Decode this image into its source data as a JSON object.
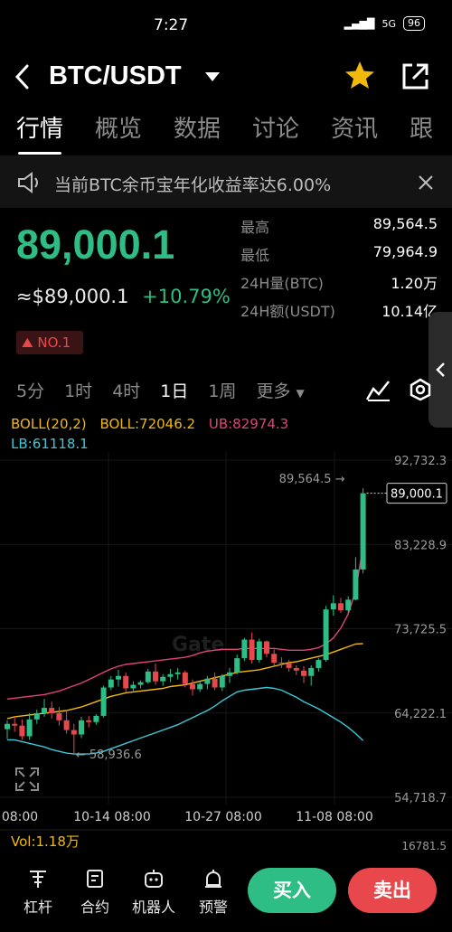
{
  "status_bar": {
    "time": "7:27",
    "battery": "96",
    "network": "5G"
  },
  "header": {
    "pair": "BTC/USDT",
    "favorite": true
  },
  "tabs": [
    "行情",
    "概览",
    "数据",
    "讨论",
    "资讯",
    "跟"
  ],
  "notice": {
    "text": "当前BTC余币宝年化收益率达6.00%"
  },
  "ticker": {
    "last_price": "89,000.1",
    "fiat_price": "≈$89,000.1",
    "change": "+10.79%",
    "rank": "NO.1",
    "stats": [
      {
        "label": "最高",
        "value": "89,564.5"
      },
      {
        "label": "最低",
        "value": "79,964.9"
      },
      {
        "label": "24H量(BTC)",
        "value": "1.20万"
      },
      {
        "label": "24H额(USDT)",
        "value": "10.14亿"
      }
    ]
  },
  "periods": {
    "items": [
      "5分",
      "1时",
      "4时",
      "1日",
      "1周",
      "更多"
    ],
    "selected": "1日"
  },
  "indicator": {
    "boll_params": "BOLL(20,2)",
    "boll": "BOLL:72046.2",
    "ub": "UB:82974.3",
    "lb": "LB:61118.1"
  },
  "chart_data": {
    "type": "candlestick",
    "y_ticks": [
      "92,732.3",
      "83,228.9",
      "73,725.5",
      "64,222.1",
      "54,718.7"
    ],
    "x_ticks": [
      "08:00",
      "10-14 08:00",
      "10-27 08:00",
      "11-08 08:00"
    ],
    "high_label": "89,564.5",
    "low_label": "58,936.6",
    "last_label": "89,000.1",
    "ylim": [
      54718.7,
      92732.3
    ],
    "candles": [
      [
        62400,
        63400,
        61300,
        63000
      ],
      [
        63000,
        63800,
        62100,
        62800
      ],
      [
        62800,
        63500,
        61200,
        61600
      ],
      [
        61600,
        64200,
        61200,
        63500
      ],
      [
        63500,
        64600,
        63000,
        64200
      ],
      [
        64200,
        65800,
        63800,
        64800
      ],
      [
        64800,
        65500,
        63600,
        64200
      ],
      [
        64200,
        64900,
        62800,
        63400
      ],
      [
        63400,
        64600,
        61900,
        62300
      ],
      [
        62300,
        63000,
        59600,
        61800
      ],
      [
        61800,
        63800,
        61400,
        63400
      ],
      [
        63400,
        63900,
        62600,
        63200
      ],
      [
        63200,
        64100,
        62900,
        63900
      ],
      [
        63900,
        67300,
        63700,
        67100
      ],
      [
        67100,
        68400,
        66800,
        68000
      ],
      [
        68000,
        69100,
        67200,
        68400
      ],
      [
        68400,
        68800,
        66600,
        67000
      ],
      [
        67000,
        67800,
        66700,
        67400
      ],
      [
        67400,
        67900,
        67000,
        67700
      ],
      [
        67700,
        69200,
        67500,
        68900
      ],
      [
        68900,
        69800,
        67400,
        67800
      ],
      [
        67800,
        68600,
        67300,
        68300
      ],
      [
        68300,
        69200,
        67700,
        68600
      ],
      [
        68600,
        69300,
        68000,
        68800
      ],
      [
        68800,
        69000,
        67100,
        67500
      ],
      [
        67500,
        68000,
        66200,
        66900
      ],
      [
        66900,
        67800,
        66600,
        67500
      ],
      [
        67500,
        68400,
        66900,
        68100
      ],
      [
        68100,
        68800,
        66800,
        67100
      ],
      [
        67100,
        68600,
        66700,
        68400
      ],
      [
        68400,
        69300,
        67600,
        68800
      ],
      [
        68800,
        70800,
        68600,
        70400
      ],
      [
        70400,
        72700,
        70100,
        72500
      ],
      [
        72500,
        73300,
        69800,
        70200
      ],
      [
        70200,
        72600,
        69900,
        72300
      ],
      [
        72300,
        72400,
        70500,
        70900
      ],
      [
        70900,
        71400,
        69600,
        69900
      ],
      [
        69900,
        70500,
        69300,
        69800
      ],
      [
        69800,
        70200,
        68900,
        69300
      ],
      [
        69300,
        69600,
        68500,
        69000
      ],
      [
        69000,
        69500,
        67600,
        68400
      ],
      [
        68400,
        69600,
        67300,
        69300
      ],
      [
        69300,
        70400,
        68900,
        70200
      ],
      [
        70200,
        76300,
        70000,
        75900
      ],
      [
        75900,
        77500,
        75200,
        76600
      ],
      [
        76600,
        77200,
        75500,
        75800
      ],
      [
        75800,
        77400,
        75500,
        77000
      ],
      [
        77000,
        81800,
        76900,
        80400
      ],
      [
        80400,
        89564.5,
        79964.9,
        89000.1
      ]
    ],
    "boll_mid": [
      63600,
      63800,
      63900,
      64000,
      64100,
      64200,
      64300,
      64400,
      64500,
      64700,
      64900,
      65200,
      65500,
      65800,
      66100,
      66300,
      66500,
      66600,
      66700,
      66800,
      66900,
      67000,
      67200,
      67300,
      67400,
      67600,
      67800,
      68000,
      68200,
      68400,
      68600,
      68800,
      68900,
      69000,
      69100,
      69300,
      69500,
      69700,
      69900,
      70000,
      70200,
      70400,
      70600,
      70800,
      71100,
      71400,
      71700,
      72000,
      72046.2
    ],
    "boll_ub": [
      65800,
      65900,
      66000,
      66100,
      66200,
      66300,
      66500,
      66700,
      67000,
      67300,
      67600,
      68000,
      68400,
      68800,
      69200,
      69500,
      69700,
      69800,
      69900,
      70000,
      70100,
      70200,
      70300,
      70400,
      70500,
      70700,
      71000,
      71200,
      71300,
      71400,
      71400,
      71400,
      71500,
      71500,
      71500,
      71500,
      71500,
      71400,
      71300,
      71300,
      71300,
      71400,
      71600,
      72000,
      72700,
      73800,
      75400,
      78000,
      82974.3
    ],
    "boll_lb": [
      61200,
      61200,
      61000,
      60800,
      60600,
      60400,
      60100,
      59900,
      59700,
      59600,
      59600,
      59600,
      59700,
      59900,
      60200,
      60500,
      60800,
      61100,
      61400,
      61700,
      62000,
      62300,
      62600,
      62900,
      63300,
      63700,
      64100,
      64500,
      65000,
      65600,
      66100,
      66600,
      66800,
      66900,
      67000,
      67100,
      67000,
      66800,
      66400,
      66000,
      65500,
      65100,
      64700,
      64200,
      63700,
      63200,
      62600,
      61900,
      61118.1
    ]
  },
  "volume": {
    "label": "Vol:1.18万",
    "axis": "16781.5"
  },
  "footer": {
    "tools": [
      "杠杆",
      "合约",
      "机器人",
      "预警"
    ],
    "buy": "买入",
    "sell": "卖出"
  },
  "colors": {
    "up": "#2ebd85",
    "down": "#e8484c",
    "boll": "#f0b90b",
    "ub": "#e0437a",
    "lb": "#3dc8d8"
  }
}
